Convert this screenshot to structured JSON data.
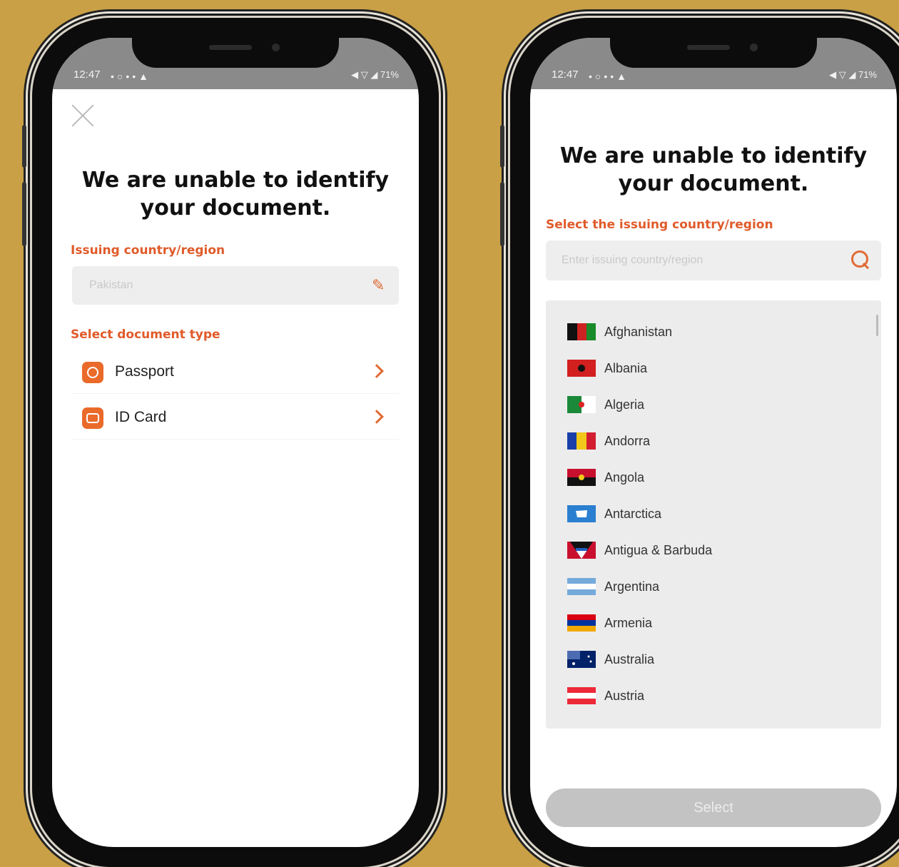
{
  "left": {
    "status": {
      "time": "12:47",
      "icons": "•○••▲",
      "right": "◀ ▽ ◢ 71%"
    },
    "title": "We are unable to identify your document.",
    "country_label": "Issuing country/region",
    "country_value": "Pakistan",
    "doc_label": "Select document type",
    "documents": [
      {
        "label": "Passport",
        "icon": "passport-icon"
      },
      {
        "label": "ID Card",
        "icon": "id-card-icon"
      }
    ]
  },
  "right": {
    "status": {
      "time": "12:47",
      "icons": "•○••▲",
      "right": "◀ ▽ ◢ 71%"
    },
    "title": "We are unable to identify your document.",
    "select_label": "Select the issuing country/region",
    "search_placeholder": "Enter issuing country/region",
    "countries": [
      {
        "name": "Afghanistan",
        "flag": "afghanistan-flag"
      },
      {
        "name": "Albania",
        "flag": "albania-flag"
      },
      {
        "name": "Algeria",
        "flag": "algeria-flag"
      },
      {
        "name": "Andorra",
        "flag": "andorra-flag"
      },
      {
        "name": "Angola",
        "flag": "angola-flag"
      },
      {
        "name": "Antarctica",
        "flag": "antarctica-flag"
      },
      {
        "name": "Antigua & Barbuda",
        "flag": "antigua-barbuda-flag"
      },
      {
        "name": "Argentina",
        "flag": "argentina-flag"
      },
      {
        "name": "Armenia",
        "flag": "armenia-flag"
      },
      {
        "name": "Australia",
        "flag": "australia-flag"
      },
      {
        "name": "Austria",
        "flag": "austria-flag"
      }
    ],
    "select_button": "Select"
  },
  "colors": {
    "background": "#c9a046",
    "accent": "#e05b2a",
    "button_disabled": "#c3c3c3"
  }
}
